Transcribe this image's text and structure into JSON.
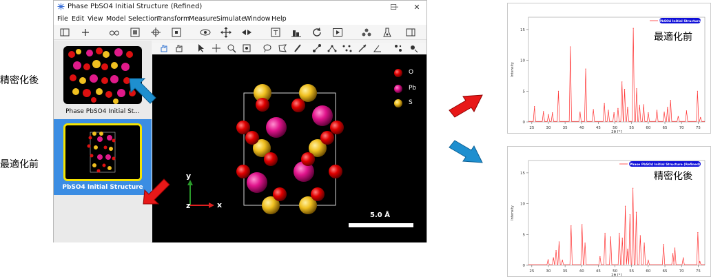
{
  "window": {
    "title": "Phase PbSO4 Initial Structure (Refined)",
    "controls": {
      "minimize": "—",
      "maximize": "☐",
      "close": "✕"
    }
  },
  "menu": [
    "File",
    "Edit",
    "View",
    "Model",
    "Selection",
    "Transform",
    "Measure",
    "Simulate",
    "Window",
    "Help"
  ],
  "sidebar": {
    "items": [
      {
        "label": "Phase PbSO4 Initial St...",
        "selected": false
      },
      {
        "label": "PbSO4 Initial Structure",
        "selected": true
      }
    ]
  },
  "viewer": {
    "legend": [
      {
        "label": "O",
        "color": "#e00000"
      },
      {
        "label": "Pb",
        "color": "#e0148c"
      },
      {
        "label": "S",
        "color": "#f0c020"
      }
    ],
    "axes": {
      "y": "y",
      "x": "x",
      "z": "z"
    },
    "scale_label": "5.0 Å"
  },
  "annotations": {
    "left_top": "精密化後",
    "left_bottom": "最適化前",
    "chart1_note": "最適化前",
    "chart2_note": "精密化後"
  },
  "chart_data": [
    {
      "type": "line",
      "legend": "PbSO4 Initial Structure",
      "xlabel": "2θ [°]",
      "ylabel": "Intensity",
      "xlim": [
        24,
        77
      ],
      "ylim": [
        0,
        17
      ],
      "xticks": [
        25,
        30,
        35,
        40,
        45,
        50,
        55,
        60,
        65,
        70,
        75
      ],
      "yticks": [
        0,
        5,
        10,
        15
      ],
      "color": "#ff3030",
      "peaks": [
        {
          "x": 25.8,
          "y": 2.5
        },
        {
          "x": 28.5,
          "y": 1.7
        },
        {
          "x": 30.0,
          "y": 1.2
        },
        {
          "x": 31.2,
          "y": 1.5
        },
        {
          "x": 33.0,
          "y": 5.0
        },
        {
          "x": 36.6,
          "y": 12.2
        },
        {
          "x": 39.5,
          "y": 1.6
        },
        {
          "x": 41.2,
          "y": 8.6
        },
        {
          "x": 43.5,
          "y": 2.0
        },
        {
          "x": 46.8,
          "y": 3.0
        },
        {
          "x": 48.0,
          "y": 1.9
        },
        {
          "x": 49.7,
          "y": 1.5
        },
        {
          "x": 50.9,
          "y": 2.2
        },
        {
          "x": 52.1,
          "y": 6.5
        },
        {
          "x": 52.9,
          "y": 5.3
        },
        {
          "x": 53.8,
          "y": 2.4
        },
        {
          "x": 55.5,
          "y": 15.2
        },
        {
          "x": 56.5,
          "y": 5.4
        },
        {
          "x": 57.4,
          "y": 2.7
        },
        {
          "x": 58.6,
          "y": 2.8
        },
        {
          "x": 60.0,
          "y": 1.5
        },
        {
          "x": 62.6,
          "y": 1.9
        },
        {
          "x": 64.8,
          "y": 1.6
        },
        {
          "x": 65.8,
          "y": 2.4
        },
        {
          "x": 66.7,
          "y": 3.5
        },
        {
          "x": 69.0,
          "y": 0.9
        },
        {
          "x": 71.5,
          "y": 1.8
        },
        {
          "x": 74.8,
          "y": 5.0
        },
        {
          "x": 75.7,
          "y": 0.7
        }
      ]
    },
    {
      "type": "line",
      "legend": "Phase PbSO4 Initial Structure (Refined)",
      "xlabel": "2θ [°]",
      "ylabel": "Intensity",
      "xlim": [
        24,
        77
      ],
      "ylim": [
        0,
        17
      ],
      "xticks": [
        25,
        30,
        35,
        40,
        45,
        50,
        55,
        60,
        65,
        70,
        75
      ],
      "yticks": [
        0,
        5,
        10,
        15
      ],
      "color": "#ff3030",
      "peaks": [
        {
          "x": 29.9,
          "y": 0.9
        },
        {
          "x": 31.5,
          "y": 1.2
        },
        {
          "x": 32.3,
          "y": 2.4
        },
        {
          "x": 33.2,
          "y": 3.8
        },
        {
          "x": 34.2,
          "y": 0.8
        },
        {
          "x": 36.8,
          "y": 6.4
        },
        {
          "x": 40.1,
          "y": 6.6
        },
        {
          "x": 41.0,
          "y": 3.6
        },
        {
          "x": 45.5,
          "y": 1.4
        },
        {
          "x": 47.0,
          "y": 5.2
        },
        {
          "x": 48.7,
          "y": 4.6
        },
        {
          "x": 51.3,
          "y": 5.2
        },
        {
          "x": 52.2,
          "y": 4.4
        },
        {
          "x": 53.1,
          "y": 9.6
        },
        {
          "x": 53.8,
          "y": 2.6
        },
        {
          "x": 54.5,
          "y": 8.2
        },
        {
          "x": 55.4,
          "y": 12.5
        },
        {
          "x": 56.4,
          "y": 8.6
        },
        {
          "x": 57.6,
          "y": 4.8
        },
        {
          "x": 58.8,
          "y": 3.6
        },
        {
          "x": 60.0,
          "y": 0.8
        },
        {
          "x": 64.6,
          "y": 3.4
        },
        {
          "x": 67.4,
          "y": 1.9
        },
        {
          "x": 68.0,
          "y": 2.8
        },
        {
          "x": 70.5,
          "y": 1.2
        },
        {
          "x": 74.9,
          "y": 5.3
        },
        {
          "x": 75.5,
          "y": 0.6
        }
      ]
    }
  ]
}
